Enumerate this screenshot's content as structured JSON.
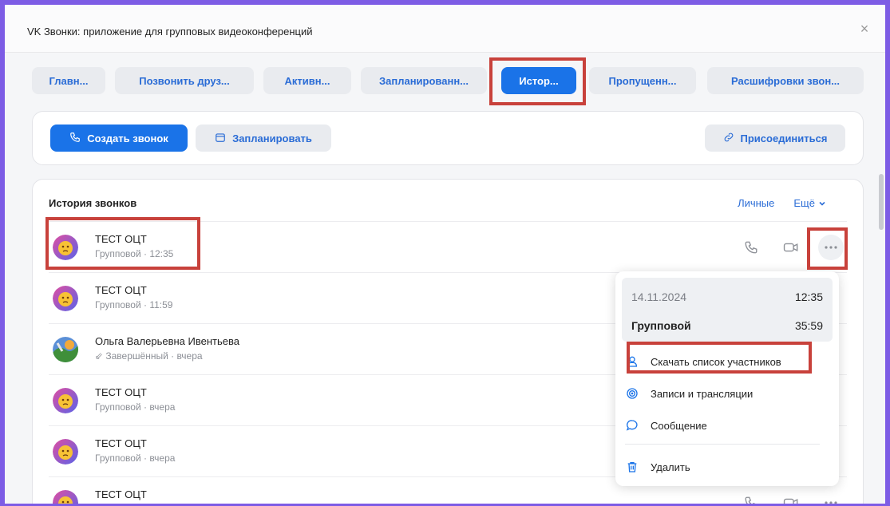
{
  "window": {
    "title": "VK Звонки: приложение для групповых видеоконференций",
    "close_glyph": "×"
  },
  "tabs": [
    {
      "label": "Главн..."
    },
    {
      "label": "Позвонить друз..."
    },
    {
      "label": "Активн..."
    },
    {
      "label": "Запланированн..."
    },
    {
      "label": "Истор...",
      "active": true
    },
    {
      "label": "Пропущенн..."
    },
    {
      "label": "Расшифровки звон..."
    }
  ],
  "actions": {
    "create_call": "Создать звонок",
    "schedule": "Запланировать",
    "join": "Присоединиться"
  },
  "history": {
    "title": "История звонков",
    "filter_personal": "Личные",
    "more_label": "Ещё",
    "rows": [
      {
        "name": "ТЕСТ ОЦТ",
        "sub": "Групповой · 12:35",
        "avatar": "emoji"
      },
      {
        "name": "ТЕСТ ОЦТ",
        "sub": "Групповой · 11:59",
        "avatar": "emoji"
      },
      {
        "name": "Ольга Валерьевна Ивентьева",
        "sub": "⇙ Завершённый · вчера",
        "avatar": "photo"
      },
      {
        "name": "ТЕСТ ОЦТ",
        "sub": "Групповой · вчера",
        "avatar": "emoji"
      },
      {
        "name": "ТЕСТ ОЦТ",
        "sub": "Групповой · вчера",
        "avatar": "emoji"
      },
      {
        "name": "ТЕСТ ОЦТ",
        "sub": "",
        "avatar": "emoji"
      }
    ]
  },
  "context_menu": {
    "date": "14.11.2024",
    "time": "12:35",
    "type": "Групповой",
    "duration": "35:59",
    "items": [
      {
        "label": "Скачать список участников",
        "icon": "person-icon"
      },
      {
        "label": "Записи и трансляции",
        "icon": "record-icon"
      },
      {
        "label": "Сообщение",
        "icon": "message-icon"
      },
      {
        "label": "Удалить",
        "icon": "trash-icon"
      }
    ]
  },
  "colors": {
    "accent": "#1a73e8",
    "highlight": "#c8413b",
    "frame": "#7d5ce5"
  }
}
